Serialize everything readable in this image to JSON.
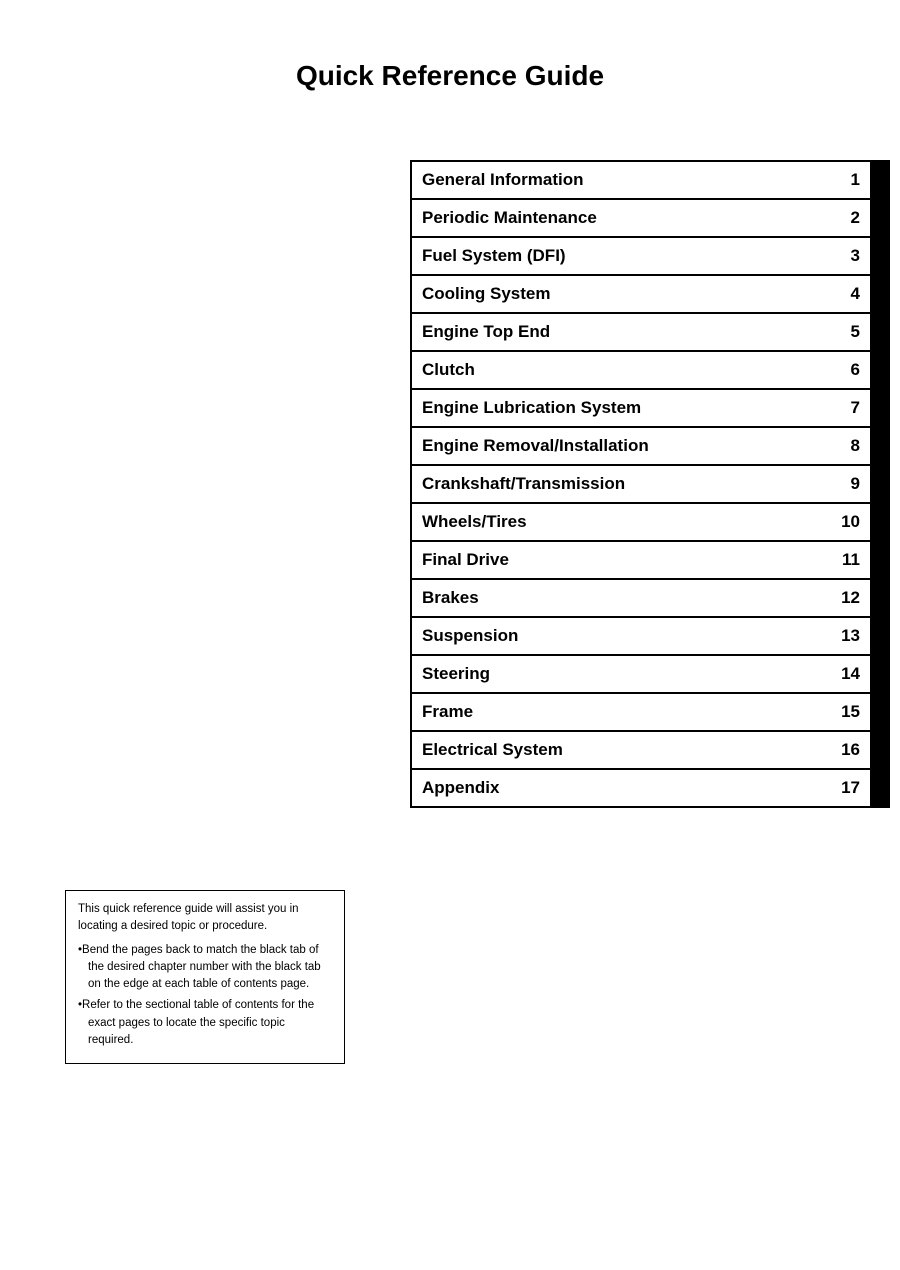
{
  "page": {
    "title": "Quick Reference Guide"
  },
  "toc": {
    "items": [
      {
        "label": "General Information",
        "number": "1"
      },
      {
        "label": "Periodic Maintenance",
        "number": "2"
      },
      {
        "label": "Fuel System (DFI)",
        "number": "3"
      },
      {
        "label": "Cooling System",
        "number": "4"
      },
      {
        "label": "Engine Top End",
        "number": "5"
      },
      {
        "label": "Clutch",
        "number": "6"
      },
      {
        "label": "Engine Lubrication System",
        "number": "7"
      },
      {
        "label": "Engine Removal/Installation",
        "number": "8"
      },
      {
        "label": "Crankshaft/Transmission",
        "number": "9"
      },
      {
        "label": "Wheels/Tires",
        "number": "10"
      },
      {
        "label": "Final Drive",
        "number": "11"
      },
      {
        "label": "Brakes",
        "number": "12"
      },
      {
        "label": "Suspension",
        "number": "13"
      },
      {
        "label": "Steering",
        "number": "14"
      },
      {
        "label": "Frame",
        "number": "15"
      },
      {
        "label": "Electrical System",
        "number": "16"
      },
      {
        "label": "Appendix",
        "number": "17"
      }
    ]
  },
  "note": {
    "intro": "This quick reference guide will assist you in locating a desired topic or procedure.",
    "bullet1": "Bend the pages back to match the black tab of the desired chapter number with the black tab on the edge at each table of contents page.",
    "bullet2": "Refer to the sectional table of contents for the exact pages to locate the specific topic required."
  }
}
